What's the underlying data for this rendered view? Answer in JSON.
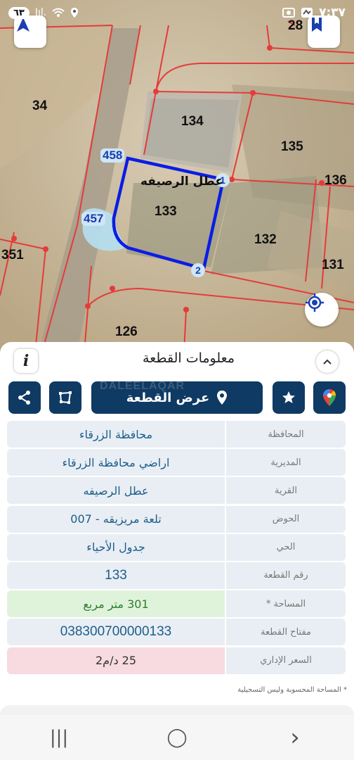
{
  "status_bar": {
    "time": "٧:٣٧",
    "battery": "٦٣",
    "signal": "Iıl."
  },
  "map": {
    "parcel_labels": [
      "28",
      "34",
      "134",
      "135",
      "136",
      "133",
      "132",
      "131",
      "351",
      "126"
    ],
    "points": [
      "458",
      "457"
    ],
    "vertex_numbers": [
      "1",
      "2"
    ],
    "village_label": "عطل الرصيفه",
    "colors": {
      "boundary": "#e53b3b",
      "selected_parcel": "#0a1de6",
      "highlight": "#b5e0f2"
    }
  },
  "sheet": {
    "title": "معلومات القطعة",
    "show_parcel_button": "عرض القطعة",
    "watermark": "DALEELAQAR",
    "rows": [
      {
        "label": "المحافظة",
        "value": "محافظة الزرقاء",
        "tone": "blue"
      },
      {
        "label": "المديرية",
        "value": "اراضي محافظة الزرقاء",
        "tone": "blue"
      },
      {
        "label": "القرية",
        "value": "عطل الرصيفه",
        "tone": "blue"
      },
      {
        "label": "الحوض",
        "value": "تلعة مريزيقه - 007",
        "tone": "blue"
      },
      {
        "label": "الحي",
        "value": "جدول الأحياء",
        "tone": "blue"
      },
      {
        "label": "رقم القطعة",
        "value": "133",
        "tone": "blue"
      },
      {
        "label": "المساحة *",
        "value": "301  متر مربع",
        "tone": "green"
      },
      {
        "label": "مفتاح القطعة",
        "value": "038300700000133",
        "tone": "blue"
      },
      {
        "label": "السعر الإداري",
        "value": "25 د/م2",
        "tone": "pink"
      }
    ],
    "footnote": "* المساحة المحسوبة وليس التسجيلية",
    "accent_color": "#0f3a63"
  },
  "nav_bar": {
    "recent": "|||",
    "home": "◯",
    "back": "›"
  }
}
